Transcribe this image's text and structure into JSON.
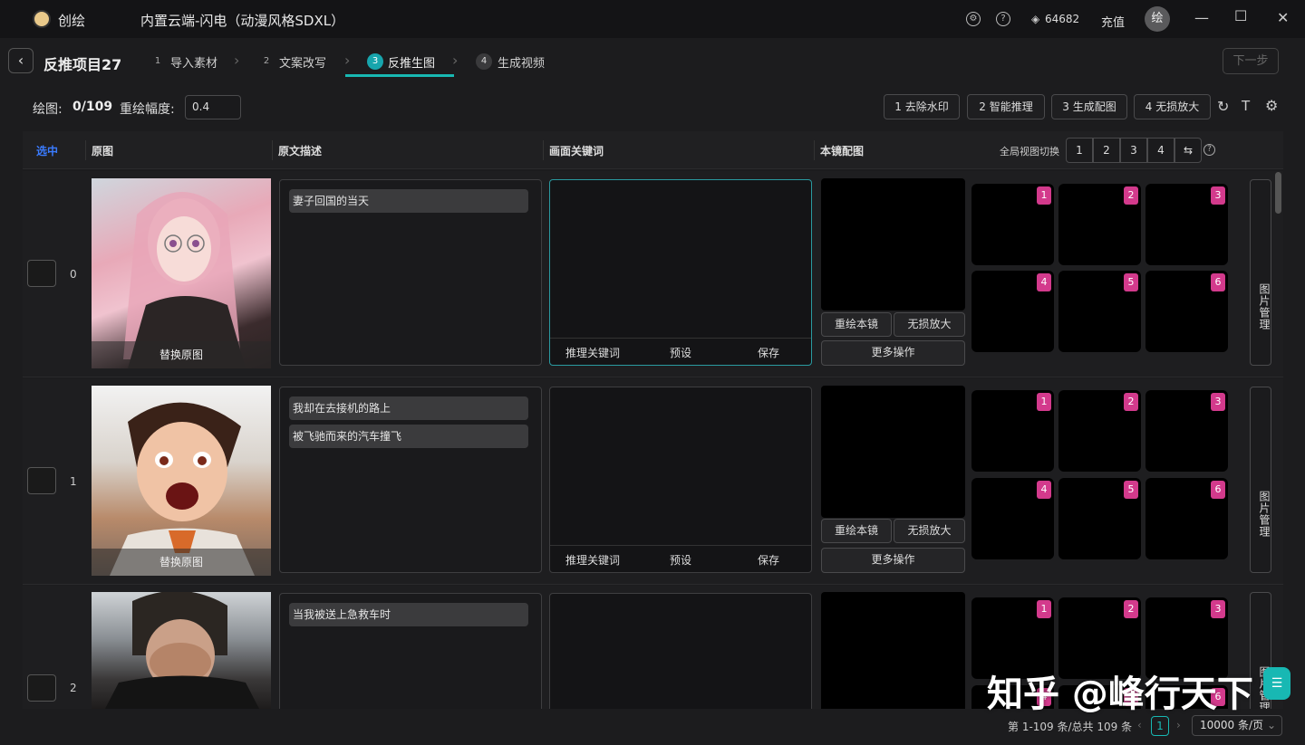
{
  "app": {
    "name": "创绘",
    "model_title": "内置云端-闪电（动漫风格SDXL）",
    "credits": "64682",
    "recharge": "充值",
    "avatar": "绘"
  },
  "icons": {
    "settings": "gear-icon",
    "help": "question-icon",
    "credits": "coin-icon"
  },
  "project": {
    "title": "反推项目27",
    "next_label": "下一步"
  },
  "steps": [
    {
      "num": "1",
      "label": "导入素材"
    },
    {
      "num": "2",
      "label": "文案改写"
    },
    {
      "num": "3",
      "label": "反推生图",
      "active": true
    },
    {
      "num": "4",
      "label": "生成视频"
    }
  ],
  "toolbar": {
    "draw_label": "绘图:",
    "draw_progress": "0/109",
    "redraw_label": "重绘幅度:",
    "redraw_value": "0.4",
    "buttons": [
      "1 去除水印",
      "2 智能推理",
      "3 生成配图",
      "4 无损放大"
    ]
  },
  "table": {
    "headers": {
      "select": "选中",
      "original": "原图",
      "desc": "原文描述",
      "keywords": "画面关键词",
      "mine": "本镜配图"
    },
    "view_switch_label": "全局视图切换",
    "view_options": [
      "1",
      "2",
      "3",
      "4"
    ],
    "replace_label": "替换原图",
    "kw_actions": [
      "推理关键词",
      "预设",
      "保存"
    ],
    "main_actions": {
      "redraw": "重绘本镜",
      "upscale": "无损放大",
      "more": "更多操作"
    },
    "grid_badges": [
      "1",
      "2",
      "3",
      "4",
      "5",
      "6"
    ],
    "manage_label": "图片管理",
    "rows": [
      {
        "index": "0",
        "lines": [
          "妻子回国的当天"
        ]
      },
      {
        "index": "1",
        "lines": [
          "我却在去接机的路上",
          "被飞驰而来的汽车撞飞"
        ]
      },
      {
        "index": "2",
        "lines": [
          "当我被送上急救车时"
        ]
      }
    ]
  },
  "footer": {
    "range": "第 1-109 条/总共 109 条",
    "page": "1",
    "page_size": "10000 条/页"
  },
  "watermark": "知乎 @峰行天下",
  "colors": {
    "accent": "#18b8b3",
    "badge": "#d33a8c",
    "header_blue": "#3a7bff"
  }
}
